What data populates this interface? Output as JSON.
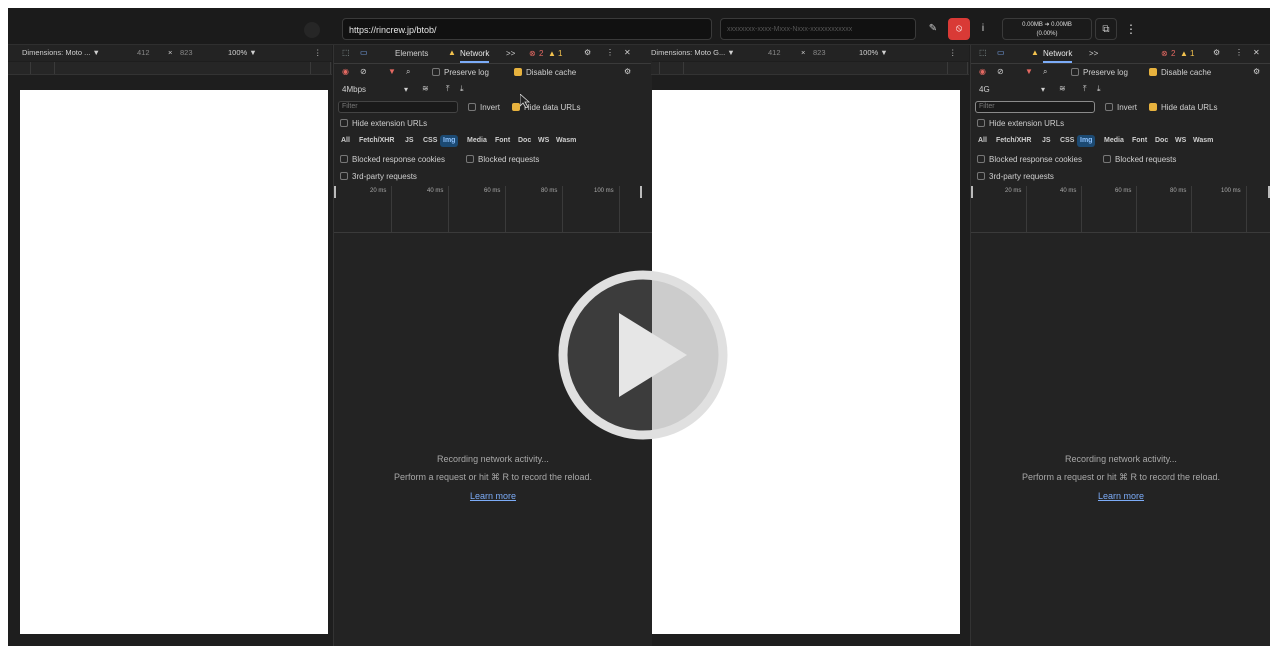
{
  "toolbar": {
    "url": "https://rincrew.jp/btob/",
    "id_placeholder": "xxxxxxxx-xxxx-Mxxx-Nxxx-xxxxxxxxxxxx",
    "stats_line1": "0.00MB ➜ 0.00MB",
    "stats_line2": "(0.00%)",
    "info_label": "i",
    "menu_label": "⋮",
    "pin_label": "✎",
    "stop_label": "⦸",
    "screen_label": "⧉"
  },
  "left": {
    "device": "Dimensions: Moto ... ▼",
    "width": "412",
    "times": "×",
    "height": "823",
    "zoom": "100% ▼",
    "throttle": "4Mbps"
  },
  "right": {
    "device": "Dimensions: Moto G... ▼",
    "width": "412",
    "times": "×",
    "height": "823",
    "zoom": "100% ▼",
    "throttle": "4G"
  },
  "devtools": {
    "tab_elements": "Elements",
    "tab_network": "Network",
    "more": ">>",
    "errors": "2",
    "warnings": "1",
    "preserve_log": "Preserve log",
    "disable_cache": "Disable cache",
    "filter_placeholder": "Filter",
    "invert": "Invert",
    "hide_data_urls": "Hide data URLs",
    "hide_extension_urls": "Hide extension URLs",
    "types": [
      "All",
      "Fetch/XHR",
      "JS",
      "CSS",
      "Img",
      "Media",
      "Font",
      "Doc",
      "WS",
      "Wasm"
    ],
    "selected_type": "Img",
    "blocked_cookies": "Blocked response cookies",
    "blocked_requests": "Blocked requests",
    "third_party": "3rd-party requests",
    "ticks": [
      "20 ms",
      "40 ms",
      "60 ms",
      "80 ms",
      "100 ms"
    ],
    "recording": "Recording network activity...",
    "perform": "Perform a request or hit ⌘ R to record the reload.",
    "learn_more": "Learn more"
  },
  "colors": {
    "accent": "#7cacf8",
    "warning": "#f3c24e",
    "error": "#e46962",
    "checkbox": "#e7b23e",
    "selected_chip": "#1c4a73"
  },
  "icons": [
    "inspect-icon",
    "device-toggle-icon",
    "gear-icon",
    "record-icon",
    "clear-icon",
    "filter-icon",
    "search-icon",
    "wifi-icon",
    "upload-icon",
    "download-icon",
    "play-icon"
  ]
}
